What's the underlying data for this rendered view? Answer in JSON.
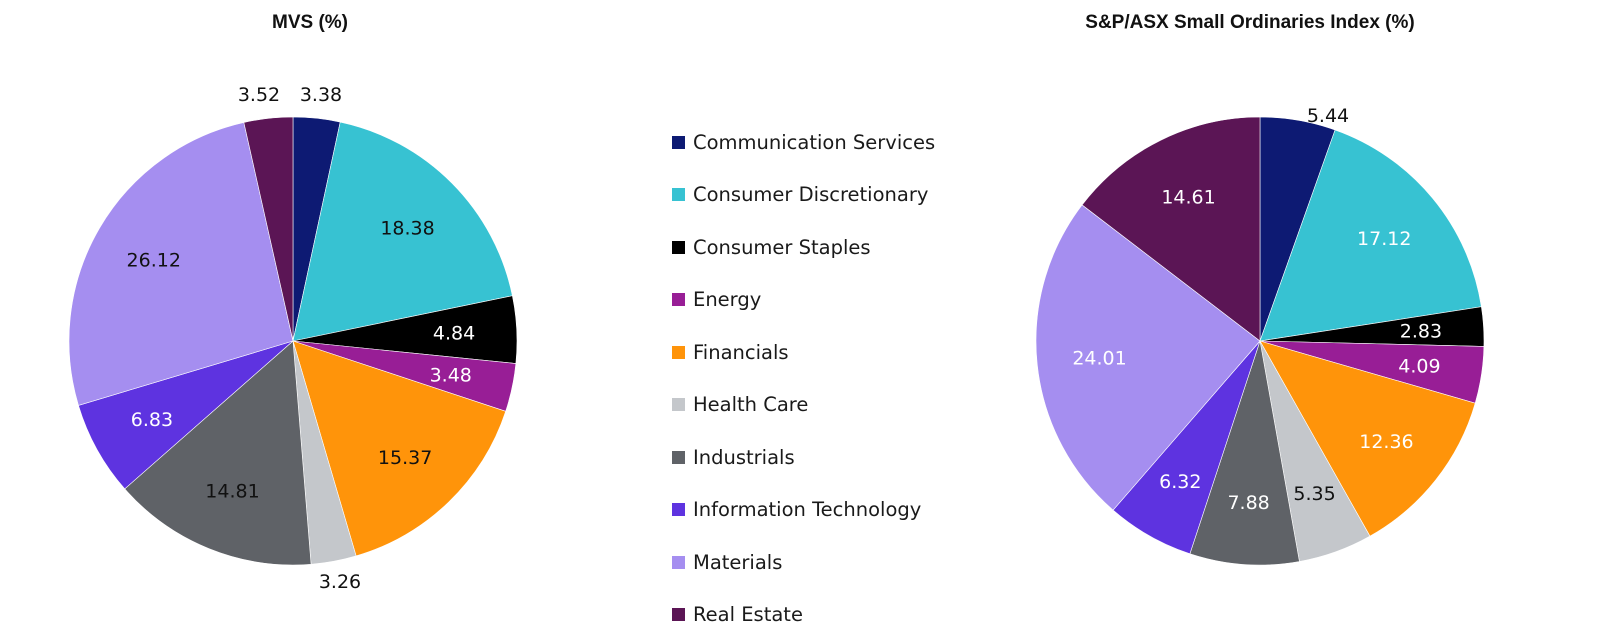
{
  "chart_data": [
    {
      "type": "pie",
      "title": "MVS (%)",
      "categories": [
        "Communication Services",
        "Consumer Discretionary",
        "Consumer Staples",
        "Energy",
        "Financials",
        "Health Care",
        "Industrials",
        "Information Technology",
        "Materials",
        "Real Estate"
      ],
      "values": [
        3.38,
        18.38,
        4.84,
        3.48,
        15.37,
        3.26,
        14.81,
        6.83,
        26.12,
        3.52
      ],
      "labels": [
        "3.38",
        "18.38",
        "4.84",
        "3.48",
        "15.37",
        "3.26",
        "14.81",
        "6.83",
        "26.12",
        "3.52"
      ],
      "start_angle": "12 o'clock",
      "direction": "clockwise"
    },
    {
      "type": "pie",
      "title": "S&P/ASX Small Ordinaries Index (%)",
      "categories": [
        "Communication Services",
        "Consumer Discretionary",
        "Consumer Staples",
        "Energy",
        "Financials",
        "Health Care",
        "Industrials",
        "Information Technology",
        "Materials",
        "Real Estate"
      ],
      "values": [
        5.44,
        17.12,
        2.83,
        4.09,
        12.36,
        5.35,
        7.88,
        6.32,
        24.01,
        14.61
      ],
      "labels": [
        "5.44",
        "17.12",
        "2.83",
        "4.09",
        "12.36",
        "5.35",
        "7.88",
        "6.32",
        "24.01",
        "14.61"
      ],
      "start_angle": "12 o'clock",
      "direction": "clockwise"
    }
  ],
  "legend": {
    "placement": "center",
    "items": [
      {
        "label": "Communication Services",
        "color": "#0d1a73"
      },
      {
        "label": "Consumer Discretionary",
        "color": "#37c2d2"
      },
      {
        "label": "Consumer Staples",
        "color": "#000000"
      },
      {
        "label": "Energy",
        "color": "#981e96"
      },
      {
        "label": "Financials",
        "color": "#ff940a"
      },
      {
        "label": "Health Care",
        "color": "#c4c7cb"
      },
      {
        "label": "Industrials",
        "color": "#5f6267"
      },
      {
        "label": "Information Technology",
        "color": "#5e33e0"
      },
      {
        "label": "Materials",
        "color": "#a58ef0"
      },
      {
        "label": "Real Estate",
        "color": "#5b1555"
      }
    ]
  },
  "label_colors": {
    "left": [
      "#111111",
      "#111111",
      "#ffffff",
      "#ffffff",
      "#111111",
      "#111111",
      "#111111",
      "#ffffff",
      "#111111",
      "#111111"
    ],
    "right": [
      "#111111",
      "#ffffff",
      "#ffffff",
      "#ffffff",
      "#ffffff",
      "#111111",
      "#ffffff",
      "#ffffff",
      "#ffffff",
      "#ffffff"
    ]
  }
}
